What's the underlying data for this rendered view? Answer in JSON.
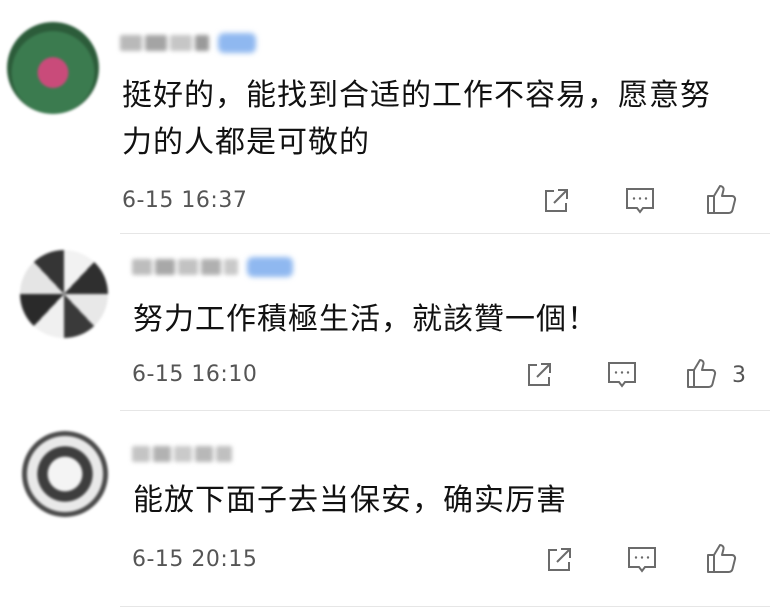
{
  "comments": [
    {
      "text_lines": [
        "挺好的，能找到合适的工作不容易，愿意努",
        "力的人都是可敬的"
      ],
      "time": "6-15 16:37",
      "like_count": ""
    },
    {
      "text_lines": [
        "努力工作積極生活，就該贊一個！"
      ],
      "time": "6-15 16:10",
      "like_count": "3"
    },
    {
      "text_lines": [
        "能放下面子去当保安，确实厉害"
      ],
      "time": "6-15 20:15",
      "like_count": ""
    }
  ],
  "icons": {
    "share": "share-icon",
    "reply": "comment-icon",
    "like": "thumbs-up-icon"
  },
  "colors": {
    "text": "#111111",
    "meta": "#555555",
    "icon": "#6b6b6b",
    "badge": "#8fb8f0",
    "divider": "#e6e6e6"
  }
}
